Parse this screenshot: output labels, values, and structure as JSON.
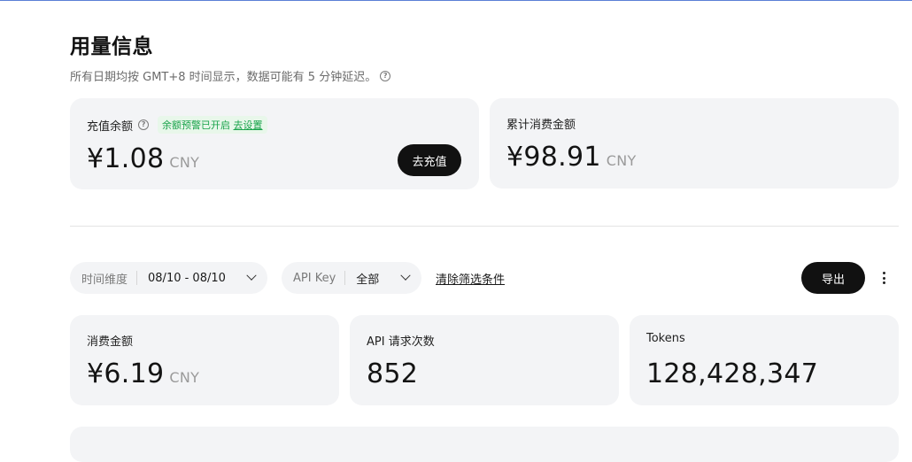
{
  "header": {
    "title": "用量信息",
    "subtitle": "所有日期均按 GMT+8 时间显示，数据可能有 5 分钟延迟。"
  },
  "balance": {
    "label": "充值余额",
    "badge_text": "余额预警已开启",
    "badge_link": "去设置",
    "amount": "¥1.08",
    "unit": "CNY",
    "recharge_label": "去充值"
  },
  "total_spend": {
    "label": "累计消费金额",
    "amount": "¥98.91",
    "unit": "CNY"
  },
  "filters": {
    "time_label": "时间维度",
    "time_value": "08/10 - 08/10",
    "api_label": "API Key",
    "api_value": "全部",
    "clear_label": "清除筛选条件",
    "export_label": "导出"
  },
  "stats": [
    {
      "label": "消费金额",
      "value": "¥6.19",
      "unit": "CNY"
    },
    {
      "label": "API 请求次数",
      "value": "852"
    },
    {
      "label": "Tokens",
      "value": "128,428,347"
    }
  ],
  "colors": {
    "accent_dark": "#111111",
    "badge_green": "#19a34a",
    "card_bg": "#f3f4f6"
  }
}
